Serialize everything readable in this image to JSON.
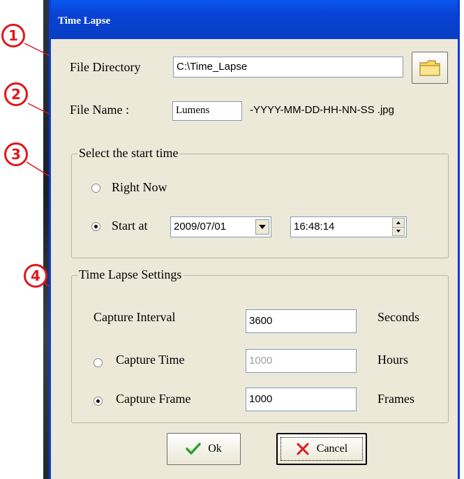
{
  "window": {
    "title": "Time Lapse"
  },
  "callouts": [
    "1",
    "2",
    "3",
    "4"
  ],
  "file_directory": {
    "label": "File Directory",
    "value": "C:\\Time_Lapse",
    "browse_icon": "folder-icon"
  },
  "file_name": {
    "label": "File Name :",
    "value": "Lumens",
    "suffix": "-YYYY-MM-DD-HH-NN-SS .jpg"
  },
  "start_time": {
    "legend": "Select the start time",
    "right_now_label": "Right Now",
    "start_at_label": "Start at",
    "selected": "start_at",
    "date_value": "2009/07/01",
    "time_value": "16:48:14"
  },
  "settings": {
    "legend": "Time Lapse Settings",
    "capture_interval": {
      "label": "Capture Interval",
      "value": "3600",
      "unit": "Seconds"
    },
    "capture_time": {
      "label": "Capture Time",
      "value": "1000",
      "unit": "Hours",
      "enabled": false
    },
    "capture_frame": {
      "label": "Capture Frame",
      "value": "1000",
      "unit": "Frames"
    },
    "selected": "capture_frame"
  },
  "buttons": {
    "ok_label": "Ok",
    "cancel_label": "Cancel"
  },
  "colors": {
    "accent_red": "#e0161b",
    "title_blue": "#0a43d6",
    "dialog_bg": "#ece9d8",
    "ok_green": "#2aa12a"
  }
}
